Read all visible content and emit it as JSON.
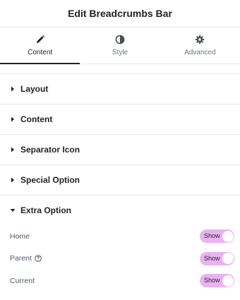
{
  "header": {
    "title": "Edit Breadcrumbs Bar"
  },
  "tabs": [
    {
      "label": "Content",
      "icon": "pencil-icon",
      "active": true
    },
    {
      "label": "Style",
      "icon": "contrast-icon",
      "active": false
    },
    {
      "label": "Advanced",
      "icon": "gear-icon",
      "active": false
    }
  ],
  "sections": [
    {
      "title": "Layout",
      "expanded": false
    },
    {
      "title": "Content",
      "expanded": false
    },
    {
      "title": "Separator Icon",
      "expanded": false
    },
    {
      "title": "Special Option",
      "expanded": false
    },
    {
      "title": "Extra Option",
      "expanded": true
    }
  ],
  "extra_option": {
    "controls": [
      {
        "label": "Home",
        "toggle_label": "Show",
        "has_help": false
      },
      {
        "label": "Parent",
        "toggle_label": "Show",
        "has_help": true
      },
      {
        "label": "Current",
        "toggle_label": "Show",
        "has_help": false
      }
    ]
  },
  "colors": {
    "text": "#1f2124",
    "muted": "#6d7882",
    "border": "#e6e8ea",
    "toggle_bg": "#eab2f2"
  }
}
